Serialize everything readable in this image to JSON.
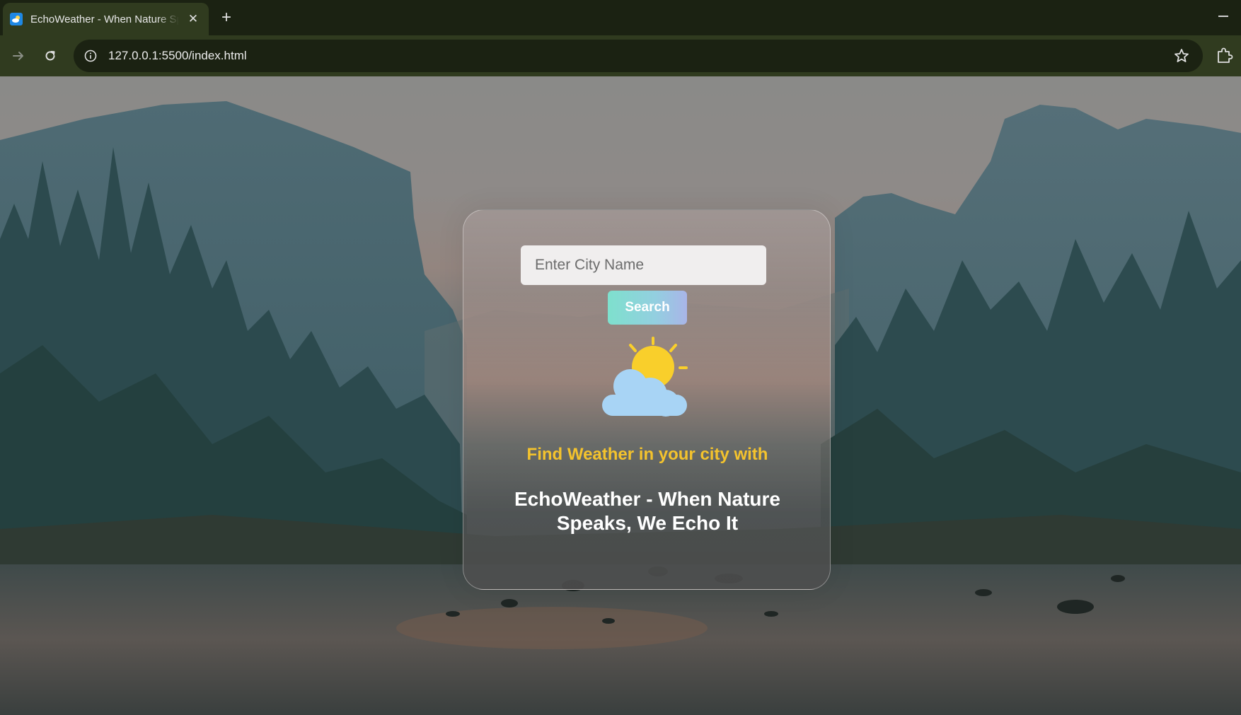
{
  "browser": {
    "tab_title": "EchoWeather - When Nature Speaks, We Echo It",
    "tab_close": "✕",
    "new_tab": "+",
    "url": "127.0.0.1:5500/index.html"
  },
  "icons": {
    "favicon": "weather-favicon",
    "back": "arrow-right-icon",
    "reload": "reload-icon",
    "site_info": "info-icon",
    "bookmark": "star-icon",
    "extensions": "puzzle-icon",
    "weather": "sun-behind-cloud-icon"
  },
  "search": {
    "placeholder": "Enter City Name",
    "value": "",
    "button_label": "Search"
  },
  "content": {
    "tagline": "Find Weather in your city with",
    "title": "EchoWeather - When Nature Speaks, We Echo It"
  },
  "colors": {
    "tagline": "#f4c32d",
    "sun": "#f9cf2b",
    "cloud": "#a8d4f5",
    "button_start": "#7ee0cd",
    "button_end": "#a9b5e8"
  }
}
